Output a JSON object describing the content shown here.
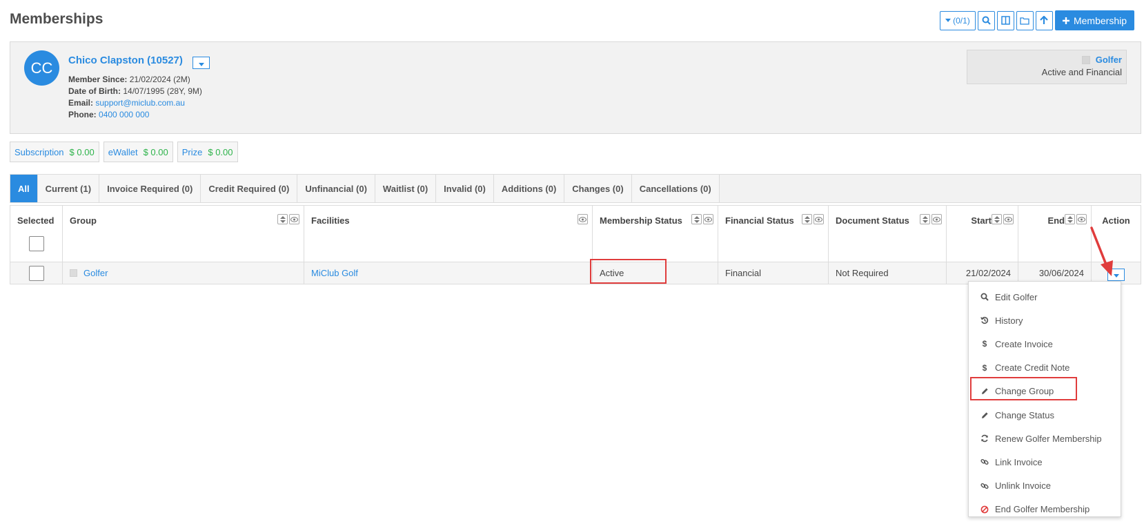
{
  "page_title": "Memberships",
  "toolbar": {
    "filter_label": "(0/1)",
    "add_label": "Membership",
    "icons": [
      "filter-icon",
      "search-icon",
      "columns-icon",
      "folder-icon",
      "arrow-up-icon",
      "plus-icon"
    ]
  },
  "member": {
    "initials": "CC",
    "name": "Chico Clapston (10527)",
    "member_since_label": "Member Since:",
    "member_since": "21/02/2024 (2M)",
    "dob_label": "Date of Birth:",
    "dob": "14/07/1995 (28Y, 9M)",
    "email_label": "Email:",
    "email": "support@miclub.com.au",
    "phone_label": "Phone:",
    "phone": "0400 000 000",
    "group": "Golfer",
    "status": "Active and Financial"
  },
  "balances": [
    {
      "label": "Subscription",
      "amount": "$ 0.00"
    },
    {
      "label": "eWallet",
      "amount": "$ 0.00"
    },
    {
      "label": "Prize",
      "amount": "$ 0.00"
    }
  ],
  "tabs": [
    {
      "label": "All",
      "active": true
    },
    {
      "label": "Current (1)"
    },
    {
      "label": "Invoice Required (0)"
    },
    {
      "label": "Credit Required (0)"
    },
    {
      "label": "Unfinancial (0)"
    },
    {
      "label": "Waitlist (0)"
    },
    {
      "label": "Invalid (0)"
    },
    {
      "label": "Additions (0)"
    },
    {
      "label": "Changes (0)"
    },
    {
      "label": "Cancellations (0)"
    }
  ],
  "table": {
    "columns": [
      "Selected",
      "Group",
      "Facilities",
      "Membership Status",
      "Financial Status",
      "Document Status",
      "Start",
      "End",
      "Action"
    ],
    "rows": [
      {
        "group": "Golfer",
        "facilities": "MiClub Golf",
        "membership_status": "Active",
        "financial_status": "Financial",
        "document_status": "Not Required",
        "start": "21/02/2024",
        "end": "30/06/2024"
      }
    ]
  },
  "action_menu": [
    {
      "label": "Edit Golfer",
      "icon": "search-icon"
    },
    {
      "label": "History",
      "icon": "history-icon"
    },
    {
      "label": "Create Invoice",
      "icon": "dollar-icon"
    },
    {
      "label": "Create Credit Note",
      "icon": "dollar-icon"
    },
    {
      "label": "Change Group",
      "icon": "pencil-icon"
    },
    {
      "label": "Change Status",
      "icon": "pencil-icon"
    },
    {
      "label": "Renew Golfer Membership",
      "icon": "refresh-icon"
    },
    {
      "label": "Link Invoice",
      "icon": "link-icon"
    },
    {
      "label": "Unlink Invoice",
      "icon": "unlink-icon"
    },
    {
      "label": "End Golfer Membership",
      "icon": "ban-icon"
    }
  ],
  "colors": {
    "accent": "#2a8be0",
    "money": "#2db34a",
    "highlight": "#e03c3c"
  }
}
